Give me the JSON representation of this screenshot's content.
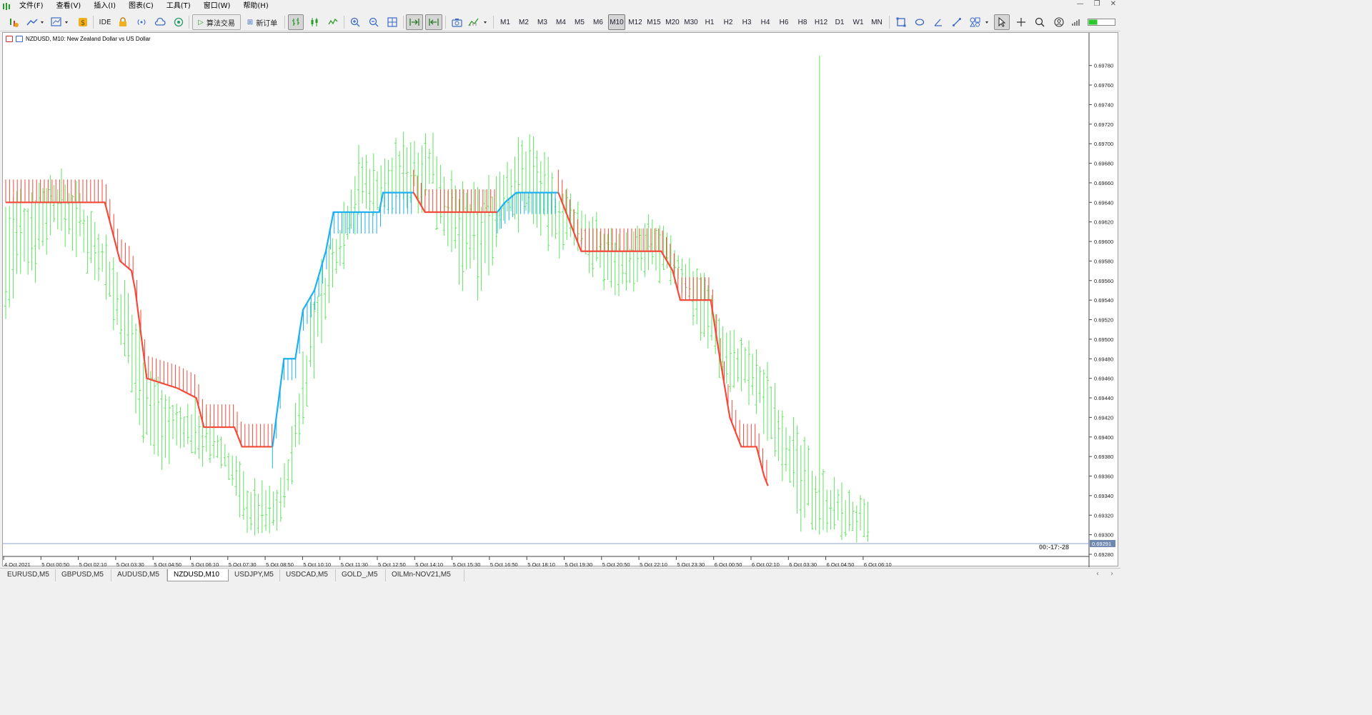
{
  "menu": {
    "items": [
      "文件(F)",
      "查看(V)",
      "插入(I)",
      "图表(C)",
      "工具(T)",
      "窗口(W)",
      "帮助(H)"
    ]
  },
  "toolbar": {
    "ide_label": "IDE",
    "algo_trading_label": "算法交易",
    "new_order_label": "新订单",
    "timeframes": [
      "M1",
      "M2",
      "M3",
      "M4",
      "M5",
      "M6",
      "M10",
      "M12",
      "M15",
      "M20",
      "M30",
      "H1",
      "H2",
      "H3",
      "H4",
      "H6",
      "H8",
      "H12",
      "D1",
      "W1",
      "MN"
    ],
    "selected_timeframe": "M10"
  },
  "chart": {
    "title": "NZDUSD, M10:  New Zealand Dollar vs US Dollar",
    "timer": "00:-17:-28",
    "current_price_label": "0.69291"
  },
  "chart_data": {
    "type": "bar",
    "symbol": "NZDUSD",
    "timeframe": "M10",
    "ylim": [
      0.6928,
      0.6979
    ],
    "yticks": [
      0.6978,
      0.6976,
      0.6974,
      0.6972,
      0.697,
      0.6968,
      0.6966,
      0.6964,
      0.6962,
      0.696,
      0.6958,
      0.6956,
      0.6954,
      0.6952,
      0.695,
      0.6948,
      0.6946,
      0.6944,
      0.6942,
      0.694,
      0.6938,
      0.6936,
      0.6934,
      0.6932,
      0.693,
      0.6928
    ],
    "ytick_labels": [
      "0.69780",
      "0.69760",
      "0.69740",
      "0.69720",
      "0.69700",
      "0.69680",
      "0.69660",
      "0.69640",
      "0.69620",
      "0.69600",
      "0.69580",
      "0.69560",
      "0.69540",
      "0.69520",
      "0.69500",
      "0.69480",
      "0.69460",
      "0.69440",
      "0.69420",
      "0.69400",
      "0.69380",
      "0.69360",
      "0.69340",
      "0.69320",
      "0.69300",
      "0.69280"
    ],
    "xtick_labels": [
      "4 Oct 2021",
      "5 Oct 00:50",
      "5 Oct 02:10",
      "5 Oct 03:30",
      "5 Oct 04:50",
      "5 Oct 06:10",
      "5 Oct 07:30",
      "5 Oct 08:50",
      "5 Oct 10:10",
      "5 Oct 11:30",
      "5 Oct 12:50",
      "5 Oct 14:10",
      "5 Oct 15:30",
      "5 Oct 16:50",
      "5 Oct 18:10",
      "5 Oct 19:30",
      "5 Oct 20:50",
      "5 Oct 22:10",
      "5 Oct 23:30",
      "6 Oct 00:50",
      "6 Oct 02:10",
      "6 Oct 03:30",
      "6 Oct 04:50",
      "6 Oct 06:10"
    ],
    "current_price": 0.69291,
    "bar_count": 233,
    "bar_color": "#5fe35f",
    "trend_up_color": "#1fb0f0",
    "trend_down_color": "#f44a3a",
    "price_line_color": "#8aa4c8",
    "hl_path": [
      [
        0,
        0.6966,
        0.695
      ],
      [
        10,
        0.6967,
        0.6955
      ],
      [
        20,
        0.6968,
        0.696
      ],
      [
        30,
        0.6966,
        0.6958
      ],
      [
        40,
        0.6962,
        0.6955
      ],
      [
        50,
        0.6956,
        0.6944
      ],
      [
        60,
        0.6948,
        0.6936
      ],
      [
        70,
        0.6944,
        0.6938
      ],
      [
        80,
        0.6944,
        0.6937
      ],
      [
        90,
        0.694,
        0.6936
      ],
      [
        100,
        0.6936,
        0.6929
      ],
      [
        110,
        0.6935,
        0.693
      ],
      [
        115,
        0.6938,
        0.6932
      ],
      [
        125,
        0.6955,
        0.6944
      ],
      [
        135,
        0.6962,
        0.6954
      ],
      [
        145,
        0.697,
        0.6962
      ],
      [
        155,
        0.6969,
        0.6962
      ],
      [
        165,
        0.6972,
        0.6963
      ],
      [
        175,
        0.6972,
        0.6963
      ],
      [
        185,
        0.6966,
        0.6955
      ],
      [
        195,
        0.6966,
        0.6954
      ],
      [
        205,
        0.697,
        0.696
      ],
      [
        215,
        0.6972,
        0.6962
      ],
      [
        225,
        0.6967,
        0.6958
      ],
      [
        235,
        0.6965,
        0.6958
      ],
      [
        245,
        0.6962,
        0.6955
      ],
      [
        255,
        0.6961,
        0.6954
      ],
      [
        265,
        0.6963,
        0.6956
      ],
      [
        275,
        0.696,
        0.6955
      ],
      [
        285,
        0.6958,
        0.695
      ],
      [
        295,
        0.6952,
        0.6945
      ],
      [
        305,
        0.695,
        0.6943
      ],
      [
        315,
        0.6947,
        0.6938
      ],
      [
        325,
        0.6941,
        0.693
      ],
      [
        335,
        0.6937,
        0.693
      ],
      [
        345,
        0.6935,
        0.6929
      ],
      [
        355,
        0.6933,
        0.6929
      ]
    ],
    "spikes": [
      [
        0.696,
        0.6934
      ],
      [
        0.697,
        0.6935
      ],
      [
        0.6976,
        0.6952
      ],
      [
        0.6973,
        0.695
      ],
      [
        0.6979,
        0.693
      ]
    ],
    "trend": [
      {
        "dir": "down",
        "pts": [
          [
            0,
            0.6964
          ],
          [
            26,
            0.6964
          ],
          [
            30,
            0.6958
          ],
          [
            33,
            0.6957
          ],
          [
            34,
            0.6955
          ],
          [
            37,
            0.6946
          ],
          [
            45,
            0.6945
          ],
          [
            50,
            0.6944
          ],
          [
            52,
            0.6941
          ],
          [
            60,
            0.6941
          ],
          [
            62,
            0.6939
          ],
          [
            70,
            0.6939
          ]
        ]
      },
      {
        "dir": "up",
        "pts": [
          [
            70,
            0.6939
          ],
          [
            73,
            0.6948
          ],
          [
            76,
            0.6948
          ],
          [
            78,
            0.6953
          ],
          [
            81,
            0.6955
          ],
          [
            84,
            0.6959
          ],
          [
            86,
            0.6963
          ],
          [
            98,
            0.6963
          ],
          [
            99,
            0.6965
          ],
          [
            107,
            0.6965
          ]
        ]
      },
      {
        "dir": "down",
        "pts": [
          [
            107,
            0.6965
          ],
          [
            110,
            0.6963
          ],
          [
            129,
            0.6963
          ]
        ]
      },
      {
        "dir": "up",
        "pts": [
          [
            129,
            0.6963
          ],
          [
            131,
            0.6964
          ],
          [
            134,
            0.6965
          ],
          [
            145,
            0.6965
          ]
        ]
      },
      {
        "dir": "down",
        "pts": [
          [
            145,
            0.6965
          ],
          [
            149,
            0.6961
          ],
          [
            151,
            0.6959
          ],
          [
            172,
            0.6959
          ],
          [
            175,
            0.6957
          ],
          [
            177,
            0.6954
          ],
          [
            185,
            0.6954
          ],
          [
            187,
            0.6949
          ],
          [
            190,
            0.6942
          ],
          [
            193,
            0.6939
          ],
          [
            197,
            0.6939
          ],
          [
            199,
            0.6936
          ],
          [
            200,
            0.6935
          ]
        ]
      }
    ]
  },
  "tabs": {
    "items": [
      "EURUSD,M5",
      "GBPUSD,M5",
      "AUDUSD,M5",
      "NZDUSD,M10",
      "USDJPY,M5",
      "USDCAD,M5",
      "GOLD_,M5",
      "OILMn-NOV21,M5"
    ],
    "active": "NZDUSD,M10"
  }
}
